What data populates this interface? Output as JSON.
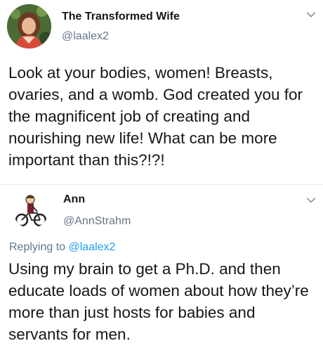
{
  "tweet": {
    "display_name": "The Transformed Wife",
    "handle": "@laalex2",
    "text": "Look at your bodies, women! Breasts, ovaries, and a womb. God created you for the magnificent job of creating and nourishing new life! What can be more important than this?!?!"
  },
  "reply": {
    "display_name": "Ann",
    "handle": "@AnnStrahm",
    "replying_prefix": "Replying to ",
    "replying_handle": "@laalex2",
    "text": "Using my brain to get a Ph.D. and then educate loads of women about how they’re more than just hosts for babies and servants for men."
  },
  "icons": {
    "chevron": "chevron-down-icon",
    "avatar_1": "avatar-photo",
    "avatar_2": "avatar-bicycle-cartoon"
  },
  "colors": {
    "handle": "#657786",
    "link": "#1da1f2",
    "text": "#14171a",
    "divider": "#e6ecf0"
  }
}
